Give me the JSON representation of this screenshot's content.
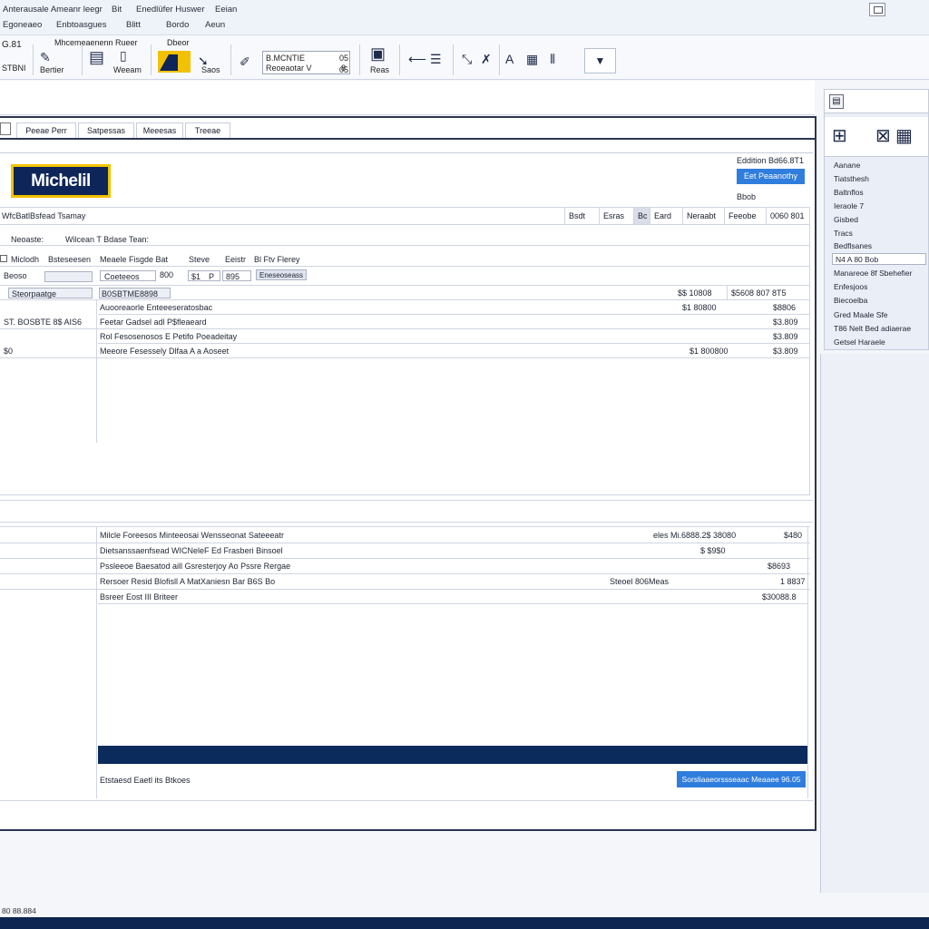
{
  "menu": {
    "row1": [
      "Anterausale Ameanr leegr",
      "Bit",
      "Enedlüfer Huswer",
      "Eeian"
    ],
    "row2": [
      "Egoneaeo",
      "Enbtoasgues",
      "Blitt",
      "Bordo",
      "Aeun"
    ]
  },
  "toolbar": {
    "left_label_top": "G.81",
    "left_label_bottom": "STBNI",
    "group1_title": "Mhcemeaenenn Rueer",
    "group2_title": "Dbeor",
    "btn1_label": "Bertier",
    "btn2_label": "Weeam",
    "btn3_label": "Saos",
    "combo_top": "B.MCNTIE",
    "combo_bottom": "Reoeaotar V",
    "combo_value": "8",
    "combo_side": "05",
    "btn4_label": "Reas",
    "dropdown_glyph": "▼"
  },
  "tabs": [
    "Peeae Perr",
    "Satpessas",
    "Meeesas",
    "Treeae"
  ],
  "brand": {
    "logo": "Michelil",
    "edition": "Eddition Bd66.8T1",
    "primary_button": "Eet Peaanothy",
    "sub_label": "Bbob"
  },
  "summary": {
    "title": "WfcBatlBsfead Tsamay",
    "cols": [
      "Bsdt",
      "Esras",
      "Bc",
      "Eard",
      "Neraabt",
      "Feeobe",
      "0060 801"
    ]
  },
  "search_row": {
    "label": "Neoaste:",
    "value": "Wilcean T Bdase Tean:"
  },
  "filter_row": {
    "text": [
      "Miclodh",
      "Bsteseesen",
      "Meaele Fisgde Bat",
      "Steve",
      "Eeistr",
      "Bl Ftv Flerey"
    ]
  },
  "table1": {
    "input_label": "Beoso",
    "field1": "Coeteeos",
    "field1_val": "800",
    "field2": "$1",
    "field2_val": "P",
    "field3": "895",
    "field3_btn": "Eneseoseass",
    "row_labels": [
      "Steorpaatge",
      "B0SBTME8898"
    ],
    "rows": [
      {
        "left": "",
        "desc": "Auooreaorle Enteeeseratosbac",
        "a": "$1 80800",
        "b": "$8806"
      },
      {
        "left": "ST. BOSBTE 8$ AIS6",
        "desc": "Feetar Gadsel adl P$fleaeard",
        "a": "",
        "b": "$3.809"
      },
      {
        "left": "",
        "desc": "Rol Fesosenosos E Petifo Poeadeitay",
        "a": "",
        "b": "$3.809"
      },
      {
        "left": "$0",
        "desc": "Meeore Fesessely Dlfaa A a Aoseet",
        "a": "$1 800800",
        "b": "$3.809"
      }
    ],
    "header_a": "$$ 10808",
    "header_b": "$5608 807 8T5"
  },
  "table2": {
    "rows": [
      {
        "desc": "Milcle Foreesos Minteeosai Wensseonat Sateeeatr",
        "a": "eles Mi.6888.2$ 38080",
        "b": "$480"
      },
      {
        "desc": "Dietsanssaenfsead WICNeleF Ed Frasberi Binsoel",
        "a": "$ $9$0",
        "b": ""
      },
      {
        "desc": "Pssleeoe Baesatod aill Gsresterjoy Ao Pssre Rergae",
        "a": "",
        "b": "$8693"
      },
      {
        "desc": "Rersoer Resid Blofisll A MatXaniesn Bar B6S Bo",
        "a": "Steoel 806Meas",
        "b": "1 8837"
      },
      {
        "desc": "Bsreer Eost III Briteer",
        "a": "",
        "b": "$30088.8"
      }
    ]
  },
  "footer": {
    "text": "Etstaesd Eaetl its Btkoes",
    "button": "Sorsliaaeorssseaac Meaaee 96.05"
  },
  "right_panel": {
    "items": [
      "Aanane",
      "Tiatsthesh",
      "Baltnflos",
      "Ieraole 7",
      "Gisbed",
      "Tracs",
      "Bedflsanes",
      "N4 A 80 Bob",
      "Manareoe 8f Sbehefier",
      "Enfesjoos",
      "Biecoelba",
      "Gred Maale Sfe",
      "T86 Nelt Bed adiaerae",
      "Getsel Haraele"
    ]
  },
  "status": "80 88.884"
}
